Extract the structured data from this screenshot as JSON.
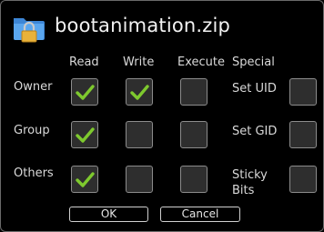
{
  "dialog": {
    "title": "bootanimation.zip",
    "icon": "locked-folder-icon"
  },
  "permissions": {
    "columns": [
      "Read",
      "Write",
      "Execute",
      "Special"
    ],
    "rows": [
      {
        "label": "Owner",
        "read": true,
        "write": true,
        "execute": false,
        "special_label": "Set UID",
        "special": false
      },
      {
        "label": "Group",
        "read": true,
        "write": false,
        "execute": false,
        "special_label": "Set GID",
        "special": false
      },
      {
        "label": "Others",
        "read": true,
        "write": false,
        "execute": false,
        "special_label": "Sticky\nBits",
        "special": false
      }
    ]
  },
  "buttons": {
    "ok": "OK",
    "cancel": "Cancel"
  },
  "colors": {
    "check": "#7ec92e",
    "checkbox_bg": "#2e2e2e",
    "checkbox_border": "#8c8c8c"
  }
}
